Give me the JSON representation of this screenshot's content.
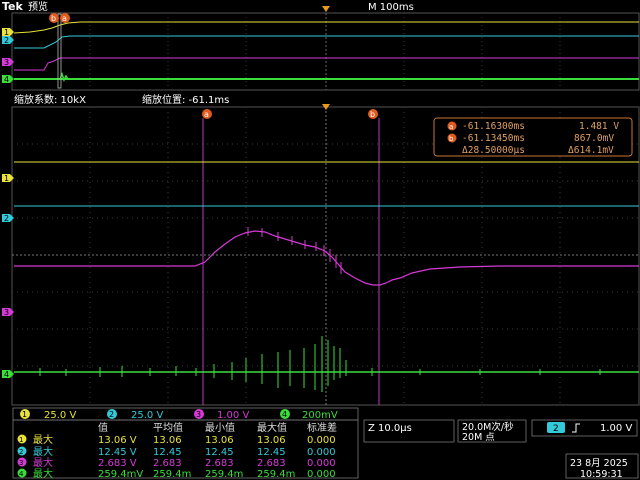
{
  "header": {
    "brand": "Tek",
    "mode": "预览",
    "timebase": "M 100ms"
  },
  "zoom": {
    "factor_label": "缩放系数: 10kX",
    "position_label": "缩放位置: -61.1ms"
  },
  "cursors": {
    "a_label": "a",
    "b_label": "b",
    "readout": {
      "a_time": "-61.16300ms",
      "a_volt": "1.481 V",
      "b_time": "-61.13450ms",
      "b_volt": "867.0mV",
      "delta_time": "Δ28.50000μs",
      "delta_volt": "Δ614.1mV"
    }
  },
  "channel_colors": {
    "ch1": "#e8e23a",
    "ch2": "#33c9d8",
    "ch3": "#d63ad6",
    "ch4": "#3add3a",
    "cursor": "#e05a1e"
  },
  "channels_bar": [
    {
      "num": "1",
      "scale": "25.0 V"
    },
    {
      "num": "2",
      "scale": "25.0 V"
    },
    {
      "num": "3",
      "scale": "1.00 V"
    },
    {
      "num": "4",
      "scale": "200mV"
    }
  ],
  "measure_table": {
    "headers": [
      "值",
      "平均值",
      "最小值",
      "最大值",
      "标准差"
    ],
    "rows": [
      {
        "ch": "1",
        "label": "最大",
        "values": [
          "13.06 V",
          "13.06",
          "13.06",
          "13.06",
          "0.000"
        ]
      },
      {
        "ch": "2",
        "label": "最大",
        "values": [
          "12.45 V",
          "12.45",
          "12.45",
          "12.45",
          "0.000"
        ]
      },
      {
        "ch": "3",
        "label": "最大",
        "values": [
          "2.683 V",
          "2.683",
          "2.683",
          "2.683",
          "0.000"
        ]
      },
      {
        "ch": "4",
        "label": "最大",
        "values": [
          "259.4mV",
          "259.4m",
          "259.4m",
          "259.4m",
          "0.000"
        ]
      }
    ]
  },
  "horizontal": {
    "zoom_scale": "Z 10.0μs",
    "sample_rate": "20.0M次/秒",
    "record_length": "20M 点"
  },
  "trigger": {
    "source": "2",
    "slope_icon": "rising-edge-icon",
    "level": "1.00 V"
  },
  "datetime": {
    "date": "23 8月  2025",
    "time": "10:59:31"
  }
}
